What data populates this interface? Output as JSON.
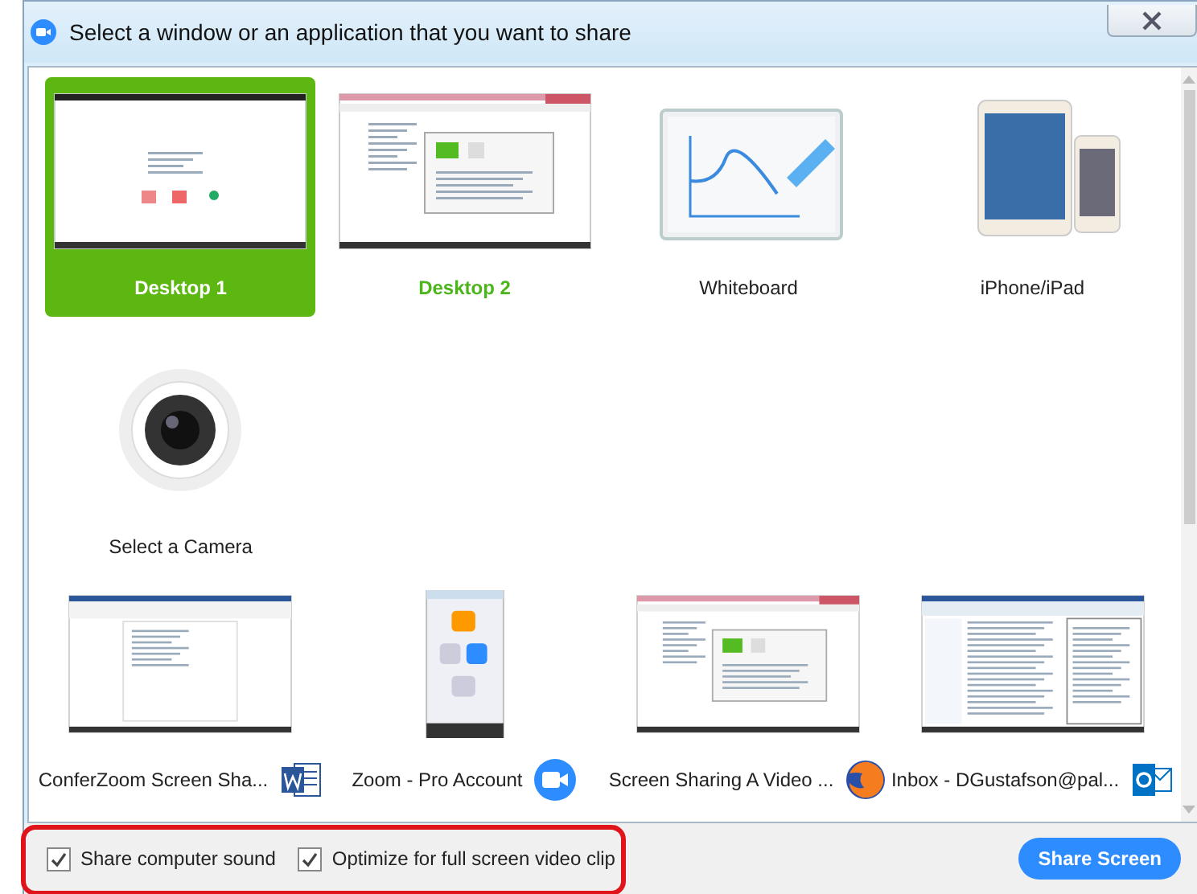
{
  "window": {
    "title": "Select a window or an application that you want to share"
  },
  "sources": [
    {
      "label": "Desktop 1",
      "kind": "desktop",
      "selected": true,
      "hovered": false
    },
    {
      "label": "Desktop 2",
      "kind": "browser",
      "selected": false,
      "hovered": true
    },
    {
      "label": "Whiteboard",
      "kind": "whiteboard",
      "selected": false,
      "hovered": false
    },
    {
      "label": "iPhone/iPad",
      "kind": "devices",
      "selected": false,
      "hovered": false
    },
    {
      "label": "Select a Camera",
      "kind": "camera",
      "selected": false,
      "hovered": false
    }
  ],
  "applications": [
    {
      "label": "ConferZoom Screen Sha...",
      "kind": "document",
      "selected": false
    },
    {
      "label": "Zoom - Pro Account",
      "kind": "meeting",
      "selected": false
    },
    {
      "label": "Screen Sharing A Video ...",
      "kind": "browser",
      "selected": false
    },
    {
      "label": "Inbox - DGustafson@pal...",
      "kind": "mail",
      "selected": false
    }
  ],
  "options": [
    {
      "label": "Share computer sound",
      "checked": true
    },
    {
      "label": "Optimize for full screen video clip",
      "checked": true
    }
  ],
  "highlight": {
    "on": true
  },
  "share_button": "Share Screen"
}
